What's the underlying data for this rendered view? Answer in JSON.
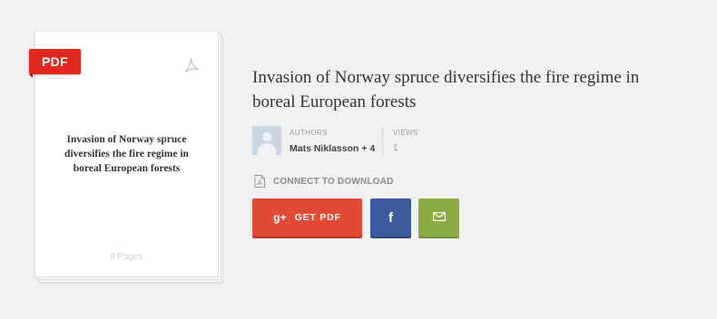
{
  "preview": {
    "badge": "PDF",
    "title": "Invasion of Norway spruce diversifies the fire regime in boreal European forests",
    "pages": "9 Pages",
    "icon": "acrobat-icon"
  },
  "document": {
    "title": "Invasion of Norway spruce diversifies the fire regime in boreal European forests"
  },
  "meta": {
    "authors_label": "AUTHORS",
    "authors_value": "Mats Niklasson + 4",
    "views_label": "VIEWS",
    "views_value": "1"
  },
  "connect": {
    "label": "CONNECT TO DOWNLOAD",
    "icon": "pdf-file-icon"
  },
  "buttons": {
    "gplus_icon_text": "g+",
    "get_pdf_label": "GET PDF",
    "facebook_icon_text": "f",
    "email_icon": "envelope-icon"
  },
  "colors": {
    "background": "#f1f1f1",
    "pdf_badge": "#e0281e",
    "google_plus": "#e14a35",
    "facebook": "#3b5b9c",
    "email": "#8aac45"
  }
}
